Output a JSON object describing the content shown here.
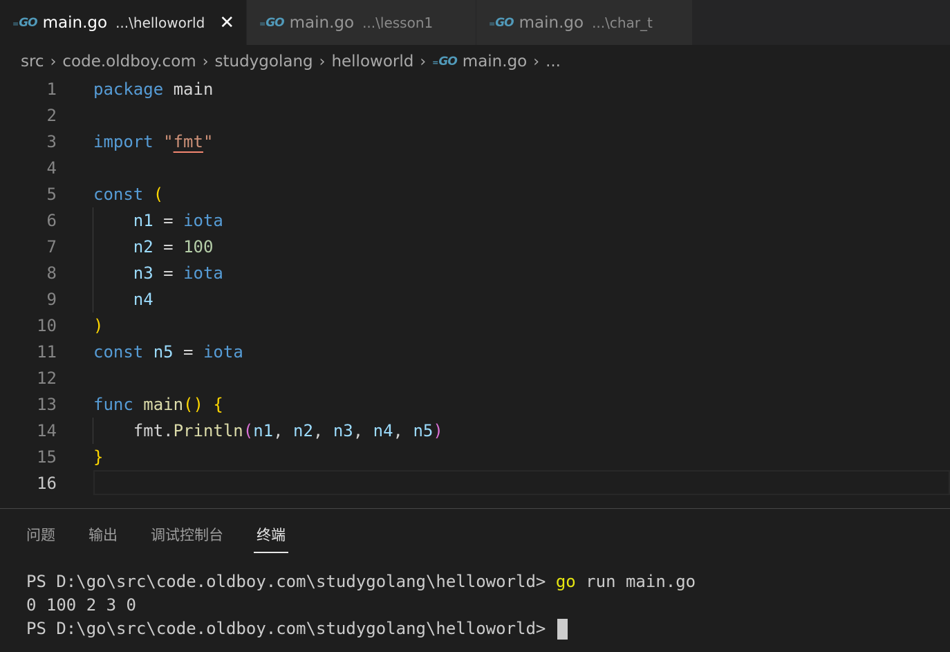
{
  "tabs": [
    {
      "icon": "GO",
      "name": "main.go",
      "desc": "...\\helloworld",
      "close": "✕"
    },
    {
      "icon": "GO",
      "name": "main.go",
      "desc": "...\\lesson1"
    },
    {
      "icon": "GO",
      "name": "main.go",
      "desc": "...\\char_t"
    }
  ],
  "breadcrumbs": {
    "items": [
      "src",
      "code.oldboy.com",
      "studygolang",
      "helloworld"
    ],
    "file_icon": "GO",
    "file": "main.go",
    "more": "...",
    "separator": "›"
  },
  "editor": {
    "language": "go",
    "lines": [
      "package main",
      "",
      "import \"fmt\"",
      "",
      "const (",
      "    n1 = iota",
      "    n2 = 100",
      "    n3 = iota",
      "    n4",
      ")",
      "const n5 = iota",
      "",
      "func main() {",
      "    fmt.Println(n1, n2, n3, n4, n5)",
      "}",
      ""
    ],
    "line_numbers": [
      "1",
      "2",
      "3",
      "4",
      "5",
      "6",
      "7",
      "8",
      "9",
      "10",
      "11",
      "12",
      "13",
      "14",
      "15",
      "16"
    ],
    "current_line": "16",
    "colors": {
      "keyword": "#569cd6",
      "variable": "#9cdcfe",
      "number": "#b5cea8",
      "string": "#ce9178",
      "function": "#dcdcaa",
      "bracket1": "#ffd700",
      "bracket2": "#da70d6"
    }
  },
  "panel": {
    "tabs": [
      "问题",
      "输出",
      "调试控制台",
      "终端"
    ],
    "active_tab": "终端",
    "terminal": {
      "prompt": "PS D:\\go\\src\\code.oldboy.com\\studygolang\\helloworld>",
      "command_go": "go",
      "command_rest": " run main.go",
      "output": "0 100 2 3 0"
    }
  }
}
